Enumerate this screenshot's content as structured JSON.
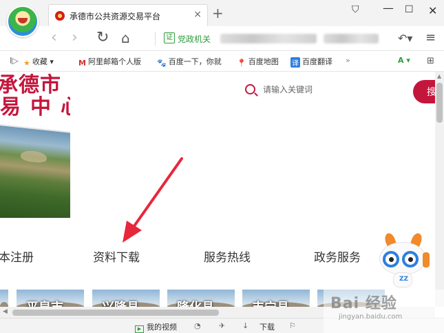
{
  "tab": {
    "title": "承德市公共资源交易平台",
    "close": "×",
    "new_tab": "+"
  },
  "window": {
    "shirt": "⛉",
    "minimize": "—",
    "maximize": "☐",
    "close": "✕"
  },
  "nav": {
    "back": "‹",
    "forward": "›",
    "refresh": "↻",
    "home": "⌂",
    "cert_icon": "证",
    "cert_label": "党政机关",
    "undo": "↶▾",
    "menu": "≡"
  },
  "bookmarks": {
    "toggle": "I▷",
    "items": [
      {
        "icon": "★",
        "label": "收藏 ▾"
      },
      {
        "icon": "M",
        "label": "阿里邮箱个人版"
      },
      {
        "icon": "🐾",
        "label": "百度一下，你就"
      },
      {
        "icon": "📍",
        "label": "百度地图"
      },
      {
        "icon": "译",
        "label": "百度翻译"
      }
    ],
    "more": "»",
    "ext_1": "A ▾",
    "ext_2": "⊞"
  },
  "banner": {
    "line_1": "承德市 )",
    "line_2": "易中心"
  },
  "search": {
    "placeholder": "请输入关键词",
    "button": "搜"
  },
  "menu": {
    "register": "本注册",
    "download": "资料下载",
    "hotline": "服务热线",
    "service": "政务服务"
  },
  "mascot": {
    "badge": "ZZ"
  },
  "thumbnails": [
    "",
    "平泉市",
    "兴隆县",
    "隆化县",
    "丰宁县",
    ""
  ],
  "scrollbars": {
    "up": "▲",
    "left": "◀"
  },
  "status": {
    "video_icon": "▶",
    "video": "我的视频",
    "speed": "◔",
    "pin": "✈",
    "download_icon": "↓",
    "download": "下载",
    "flag": "⚐"
  },
  "watermark": {
    "text": "Bai 经验",
    "url": "jingyan.baidu.com"
  },
  "colors": {
    "brand_red": "#c4163c",
    "cert_green": "#2f9d3a",
    "arrow_red": "#e8273b"
  }
}
